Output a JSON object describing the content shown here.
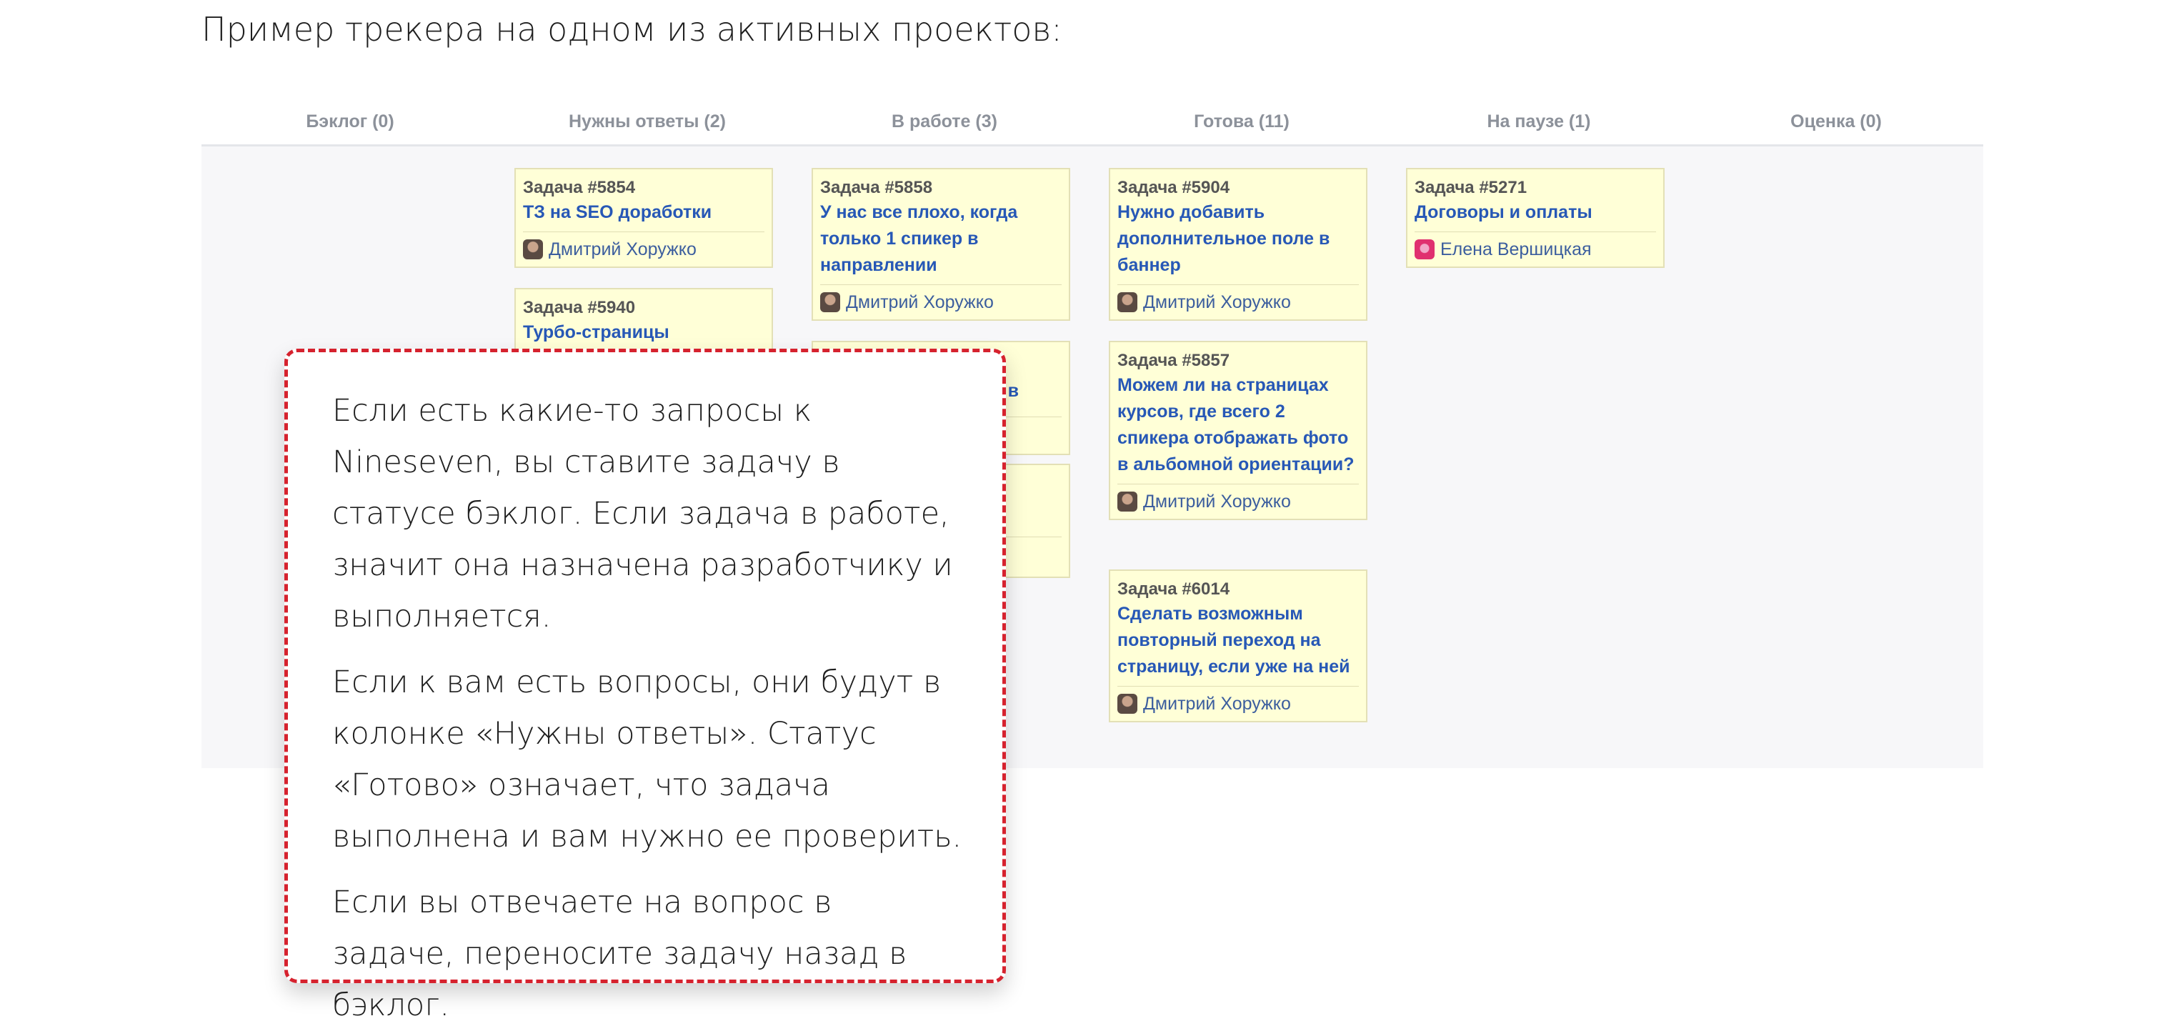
{
  "intro": "Пример трекера на одном из активных проектов:",
  "columns": [
    {
      "title": "Бэклог (0)"
    },
    {
      "title": "Нужны ответы (2)"
    },
    {
      "title": "В работе (3)"
    },
    {
      "title": "Готова (11)"
    },
    {
      "title": "На паузе (1)"
    },
    {
      "title": "Оценка (0)"
    }
  ],
  "cards": {
    "c5854": {
      "num": "Задача #5854",
      "title": "ТЗ на SEO доработки",
      "user": "Дмитрий Хоружко"
    },
    "c5940": {
      "num": "Задача #5940",
      "title": "Турбо-страницы"
    },
    "c5858": {
      "num": "Задача #5858",
      "title": "У нас все плохо, когда только 1 спикер в направлении",
      "user": "Дмитрий Хоружко"
    },
    "c5904": {
      "num": "Задача #5904",
      "title": "Нужно добавить дополнительное поле в баннер",
      "user": "Дмитрий Хоружко"
    },
    "c5857": {
      "num": "Задача #5857",
      "title": "Можем ли на страницах курсов, где всего 2 спикера отображать фото в альбомной ориентации?",
      "user": "Дмитрий Хоружко"
    },
    "c6014": {
      "num": "Задача #6014",
      "title": "Сделать возможным повторный переход на страницу, если уже на ней",
      "user": "Дмитрий Хоружко"
    },
    "c5271": {
      "num": "Задача #5271",
      "title": "Договоры и оплаты",
      "user": "Елена Вершицкая"
    },
    "partial_title": "в"
  },
  "callout": {
    "p1": "Если есть какие-то запросы к Nineseven, вы ставите задачу в статусе бэклог. Если задача в работе, значит она назначена разработчику и выполняется.",
    "p2": "Если к вам есть вопросы, они будут в колонке «Нужны ответы». Статус «Готово» означает, что задача выполнена и вам нужно ее проверить.",
    "p3": "Если вы отвечаете на вопрос в задаче, переносите задачу назад в бэклог."
  },
  "colors": {
    "card_bg": "#ffffd7",
    "link": "#2758b6",
    "callout_border": "#d6222e"
  }
}
